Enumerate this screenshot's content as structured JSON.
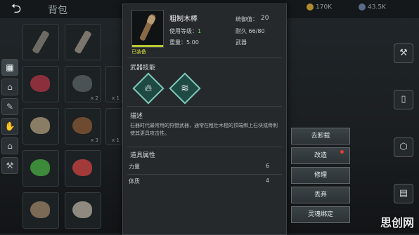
{
  "topbar": {
    "title": "背包",
    "res1": "170K",
    "res2": "43.5K"
  },
  "tabs": [
    "▦",
    "⌂",
    "✎",
    "✋",
    "⌂",
    "⚒"
  ],
  "grid_qty": [
    "",
    "",
    "",
    "x 2",
    "x 1",
    "",
    "x 3",
    "x 1",
    "",
    "",
    "",
    ""
  ],
  "panel": {
    "item_name": "粗制木棒",
    "equipped": "已装备",
    "use_level_label": "使用等级：",
    "use_level_value": "1",
    "weight_label": "重量：",
    "weight_value": "5.00",
    "stat1_label": "统御值：",
    "stat1_value": "20",
    "durability_label": "耐久",
    "durability_value": "66/80",
    "type_label": "武器",
    "skills_title": "武器技能",
    "skill_icons": [
      "fire-icon",
      "wind-icon"
    ],
    "desc_title": "描述",
    "desc_text": "石器时代最常用的狩猎武器，通常在粗壮木棍的顶端绑上石块或骨刺使其更具攻击性。",
    "attrs_title": "道具属性",
    "attrs": [
      {
        "label": "力量",
        "value": "6"
      },
      {
        "label": "体质",
        "value": "4"
      }
    ]
  },
  "actions": [
    "去卸载",
    "改造",
    "修理",
    "丢弃",
    "灵魂绑定"
  ],
  "watermark": "思创网"
}
